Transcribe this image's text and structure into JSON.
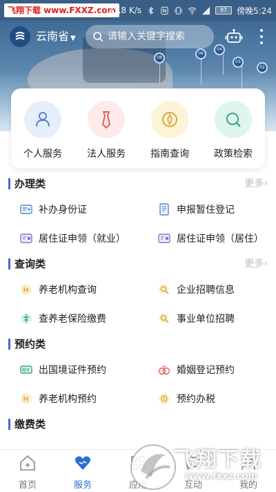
{
  "status_bar": {
    "watermark": "飞翔下载 www.FXXZ.com",
    "speed": "33.8 K/s",
    "battery": "97",
    "time": "傍晚5:24"
  },
  "header": {
    "region": "云南省",
    "search_placeholder": "请输入关键字搜索",
    "banner_tags": [
      "08",
      "06",
      "04",
      "03",
      "02"
    ]
  },
  "quick_services": [
    {
      "label": "个人服务",
      "icon": "person-icon",
      "bg": "#e6eefb",
      "color": "#5b7fc7"
    },
    {
      "label": "法人服务",
      "icon": "tie-icon",
      "bg": "#fdeaea",
      "color": "#e2605a"
    },
    {
      "label": "指南查询",
      "icon": "compass-icon",
      "bg": "#fdf3d6",
      "color": "#d9a63a"
    },
    {
      "label": "政策检索",
      "icon": "magnifier-icon",
      "bg": "#e0f5ee",
      "color": "#34a57e"
    }
  ],
  "sections": [
    {
      "title": "办理类",
      "more": "更多",
      "items": [
        {
          "label": "补办身份证",
          "icon": "id-card-icon"
        },
        {
          "label": "申报暂住登记",
          "icon": "document-icon"
        },
        {
          "label": "居住证申领（就业）",
          "icon": "residence-card-icon"
        },
        {
          "label": "居住证申领（居住）",
          "icon": "residence-card-icon"
        }
      ]
    },
    {
      "title": "查询类",
      "more": "更多",
      "items": [
        {
          "label": "养老机构查询",
          "icon": "elderly-icon"
        },
        {
          "label": "企业招聘信息",
          "icon": "search-doc-icon"
        },
        {
          "label": "查养老保险缴费",
          "icon": "insurance-icon"
        },
        {
          "label": "事业单位招聘",
          "icon": "search-doc-icon"
        }
      ]
    },
    {
      "title": "预约类",
      "more": "",
      "items": [
        {
          "label": "出国境证件预约",
          "icon": "passport-icon"
        },
        {
          "label": "婚姻登记预约",
          "icon": "marriage-icon"
        },
        {
          "label": "养老机构预约",
          "icon": "elderly-icon"
        },
        {
          "label": "预约办税",
          "icon": "tax-icon"
        }
      ]
    },
    {
      "title": "缴费类",
      "more": "",
      "items": []
    }
  ],
  "bottom_nav": [
    {
      "label": "首页",
      "icon": "home-icon",
      "active": false
    },
    {
      "label": "服务",
      "icon": "heart-icon",
      "active": true
    },
    {
      "label": "应用",
      "icon": "apps-icon",
      "active": false
    },
    {
      "label": "互动",
      "icon": "chat-icon",
      "active": false
    },
    {
      "label": "我的",
      "icon": "user-icon",
      "active": false
    }
  ],
  "watermark": {
    "brand": "飞翔下载",
    "url": "www.fxxz.com"
  },
  "colors": {
    "accent": "#2d6fd2",
    "section_bar": "#3a6fd8",
    "header_blue": "#3a5f86"
  }
}
